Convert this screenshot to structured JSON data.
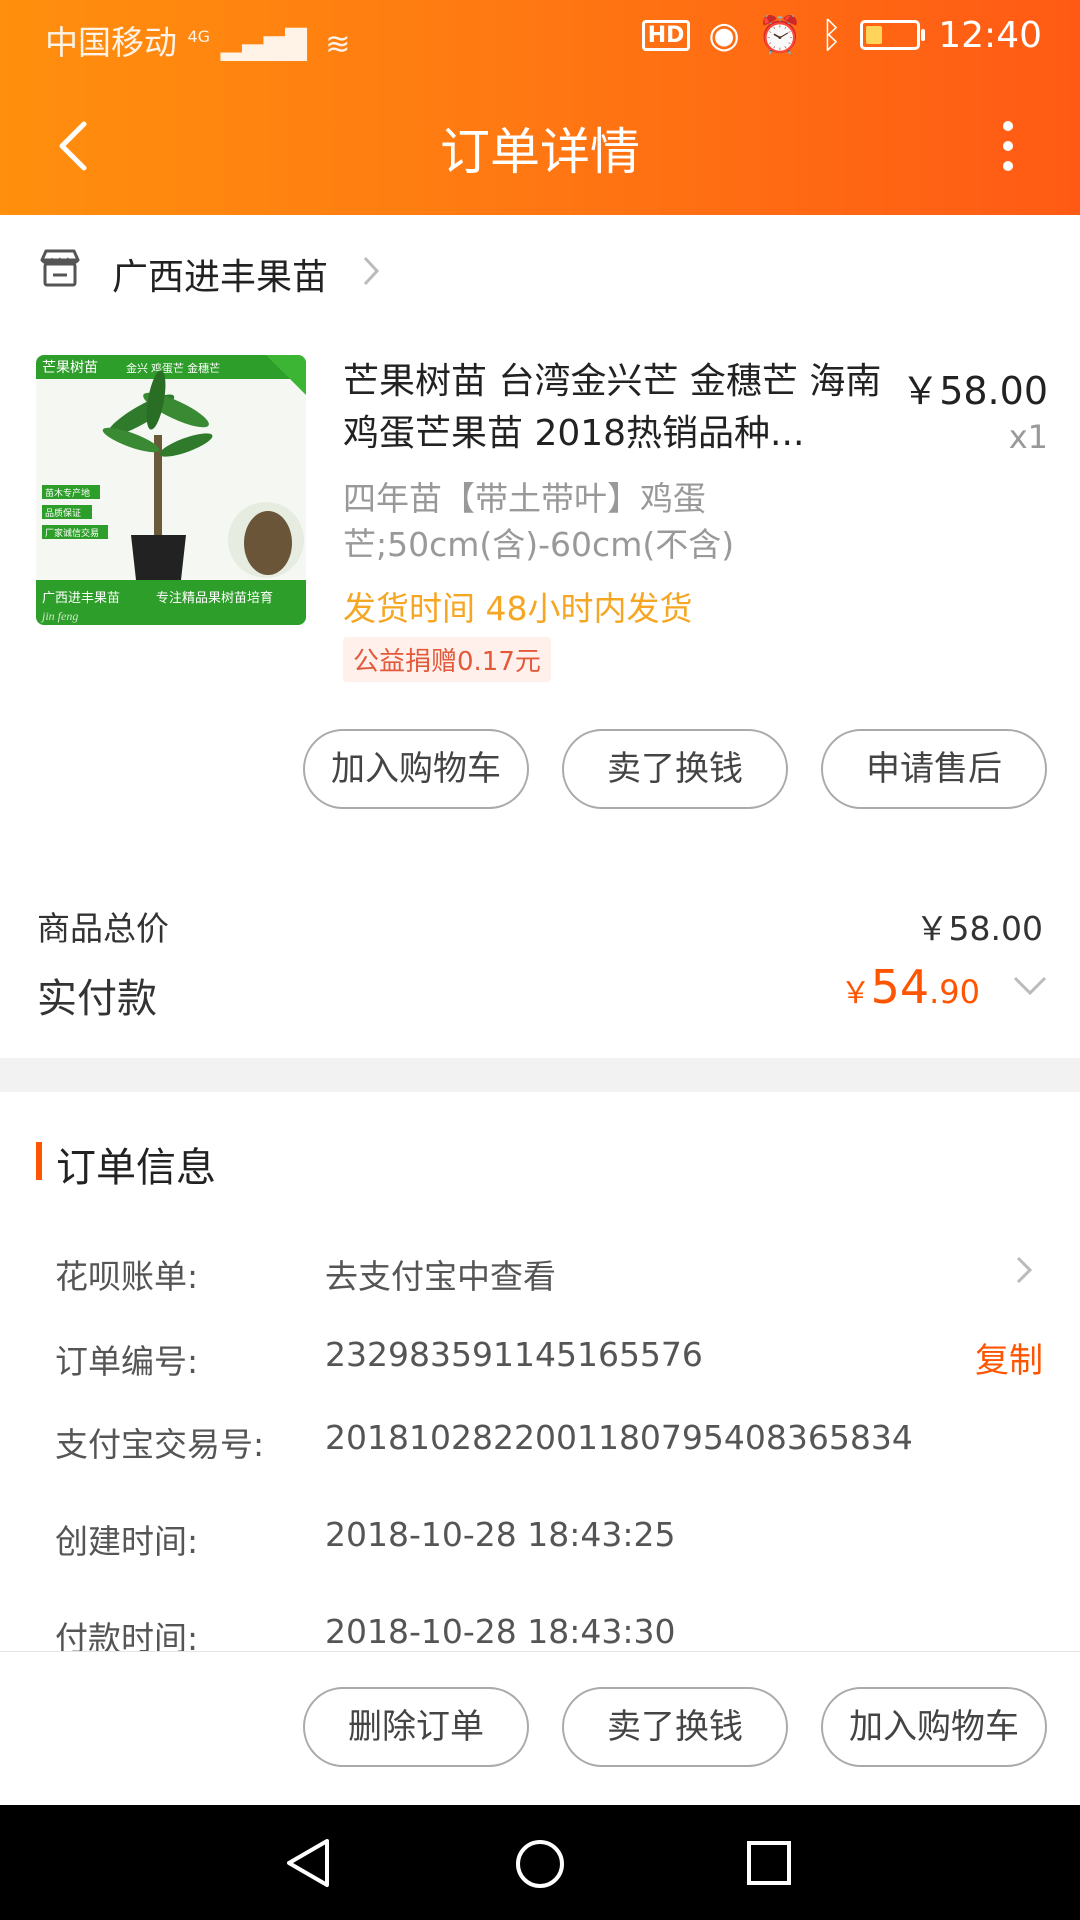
{
  "status_bar": {
    "carrier": "中国移动",
    "network": "4G",
    "time": "12:40",
    "hd": "HD"
  },
  "header": {
    "title": "订单详情"
  },
  "shop": {
    "name": "广西进丰果苗"
  },
  "product": {
    "title": "芒果树苗 台湾金兴芒 金穗芒 海南鸡蛋芒果苗 2018热销品种...",
    "price": "￥58.00",
    "quantity": "x1",
    "sku": "四年苗【带土带叶】鸡蛋芒;50cm(含)-60cm(不含)",
    "ship_time": "发货时间 48小时内发货",
    "charity": "公益捐赠0.17元",
    "image_text": {
      "top_left": "芒果树苗",
      "top_middle": "金兴 鸡蛋芒 金穗芒",
      "badges": [
        "苗木专产地",
        "品质保证",
        "厂家诚信交易"
      ],
      "bottom_left": "广西进丰果苗",
      "bottom_right": "专注精品果树苗培育",
      "watermark": "jin feng"
    }
  },
  "item_actions": {
    "add_to_cart": "加入购物车",
    "sell": "卖了换钱",
    "after_sale": "申请售后"
  },
  "totals": {
    "goods_total_label": "商品总价",
    "goods_total_value": "￥58.00",
    "paid_label": "实付款",
    "paid_symbol": "￥",
    "paid_integer": "54",
    "paid_decimal": ".90"
  },
  "order_info": {
    "title": "订单信息",
    "huabei_label": "花呗账单:",
    "huabei_value": "去支付宝中查看",
    "order_no_label": "订单编号:",
    "order_no_value": "232983591145165576",
    "copy_label": "复制",
    "alipay_no_label": "支付宝交易号:",
    "alipay_no_value": "2018102822001180795408365834",
    "created_label": "创建时间:",
    "created_value": "2018-10-28 18:43:25",
    "paid_time_label": "付款时间:",
    "paid_time_value": "2018-10-28 18:43:30"
  },
  "bottom_actions": {
    "delete": "删除订单",
    "sell": "卖了换钱",
    "add_to_cart": "加入购物车"
  },
  "colors": {
    "header_start": "#ff8f0d",
    "header_end": "#ff5a14",
    "accent": "#ff5500",
    "ship_time": "#f5a623"
  }
}
